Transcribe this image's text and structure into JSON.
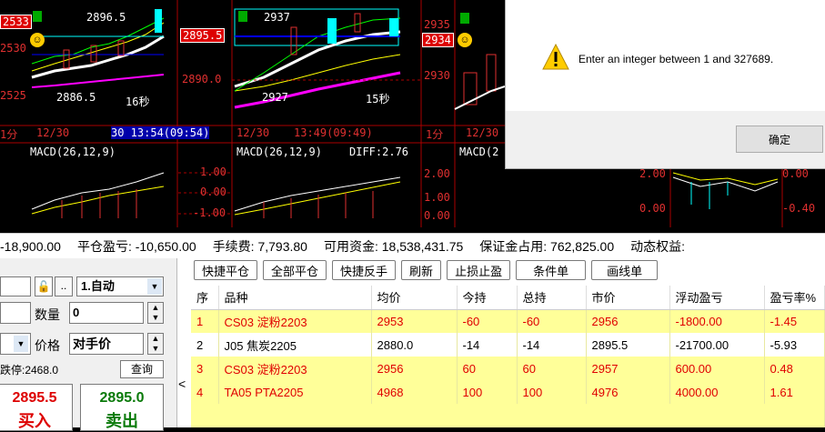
{
  "chart_panes": [
    {
      "name": "pane1",
      "price_hi": "2896.5",
      "price_lo": "2886.5",
      "box_price": "2533",
      "period": "16秒",
      "date_label": "12/30",
      "time_label": "30 13:54(09:54)",
      "macd_label": "MACD(26,12,9)",
      "scale_prices": [
        "2530",
        "2525"
      ]
    },
    {
      "name": "pane2",
      "price_hi": "2937",
      "price_lo": "2927",
      "box_price": "2895.5",
      "period": "15秒",
      "date_label": "12/30",
      "time_label": "13:49(09:49)",
      "macd_label": "MACD(26,12,9)",
      "diff_label": "DIFF:2.76",
      "scale_prices": [
        "2890.0"
      ],
      "macd_scale": [
        "1.00",
        "0.00",
        "-1.00"
      ]
    },
    {
      "name": "pane3",
      "box_price": "2934",
      "period_label": "1分",
      "date_label": "12/30",
      "macd_label": "MACD(2",
      "scale_prices": [
        "2935",
        "2930"
      ],
      "macd_scale": [
        "2.00",
        "1.00",
        "0.00"
      ]
    },
    {
      "name": "pane4",
      "macd_scale": [
        "2.00",
        "0.00"
      ]
    },
    {
      "name": "pane5",
      "macd_scale": [
        "0.00",
        "-0.40"
      ]
    }
  ],
  "pane1_extra": {
    "period_label": "1分"
  },
  "dialog": {
    "message": "Enter an integer between 1 and 327689.",
    "ok_label": "确定",
    "icon": "warning-icon"
  },
  "status_bar": {
    "item0": "-18,900.00",
    "item1": "平仓盈亏: -10,650.00",
    "item2": "手续费: 7,793.80",
    "item3": "可用资金: 18,538,431.75",
    "item4": "保证金占用: 762,825.00",
    "item5": "动态权益:"
  },
  "order_panel": {
    "mode_value": "1.自动",
    "qty_label": "数量",
    "qty_value": "0",
    "price_label": "价格",
    "price_value": "对手价",
    "limit_down_text": "跌停:2468.0",
    "query_button": "查询",
    "buy_price": "2895.5",
    "sell_price": "2895.0",
    "buy_label": "买入",
    "sell_label": "卖出",
    "dots_button": ".."
  },
  "toolbar": {
    "buttons": [
      "快捷平仓",
      "全部平仓",
      "快捷反手",
      "刷新",
      "止损止盈",
      "条件单",
      "画线单"
    ]
  },
  "positions": {
    "columns": [
      "序",
      "品种",
      "均价",
      "今持",
      "总持",
      "市价",
      "浮动盈亏",
      "盈亏率%"
    ],
    "rows": [
      [
        "1",
        "CS03 淀粉2203",
        "2953",
        "-60",
        "-60",
        "2956",
        "-1800.00",
        "-1.45"
      ],
      [
        "2",
        "J05 焦炭2205",
        "2880.0",
        "-14",
        "-14",
        "2895.5",
        "-21700.00",
        "-5.93"
      ],
      [
        "3",
        "CS03 淀粉2203",
        "2956",
        "60",
        "60",
        "2957",
        "600.00",
        "0.48"
      ],
      [
        "4",
        "TA05 PTA2205",
        "4968",
        "100",
        "100",
        "4976",
        "4000.00",
        "1.61"
      ]
    ]
  },
  "colors": {
    "up": "#e00000",
    "row_highlight": "#ffff99",
    "chart_bg": "#000000",
    "axis_red": "#c00000"
  }
}
